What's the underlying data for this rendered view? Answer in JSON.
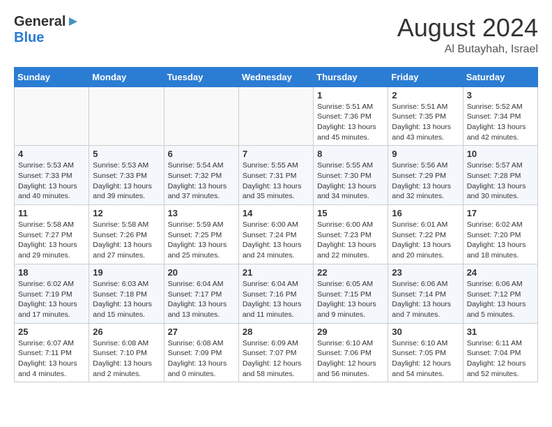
{
  "header": {
    "logo_general": "General",
    "logo_blue": "Blue",
    "month_year": "August 2024",
    "location": "Al Butayhah, Israel"
  },
  "weekdays": [
    "Sunday",
    "Monday",
    "Tuesday",
    "Wednesday",
    "Thursday",
    "Friday",
    "Saturday"
  ],
  "weeks": [
    [
      {
        "day": "",
        "info": ""
      },
      {
        "day": "",
        "info": ""
      },
      {
        "day": "",
        "info": ""
      },
      {
        "day": "",
        "info": ""
      },
      {
        "day": "1",
        "info": "Sunrise: 5:51 AM\nSunset: 7:36 PM\nDaylight: 13 hours\nand 45 minutes."
      },
      {
        "day": "2",
        "info": "Sunrise: 5:51 AM\nSunset: 7:35 PM\nDaylight: 13 hours\nand 43 minutes."
      },
      {
        "day": "3",
        "info": "Sunrise: 5:52 AM\nSunset: 7:34 PM\nDaylight: 13 hours\nand 42 minutes."
      }
    ],
    [
      {
        "day": "4",
        "info": "Sunrise: 5:53 AM\nSunset: 7:33 PM\nDaylight: 13 hours\nand 40 minutes."
      },
      {
        "day": "5",
        "info": "Sunrise: 5:53 AM\nSunset: 7:33 PM\nDaylight: 13 hours\nand 39 minutes."
      },
      {
        "day": "6",
        "info": "Sunrise: 5:54 AM\nSunset: 7:32 PM\nDaylight: 13 hours\nand 37 minutes."
      },
      {
        "day": "7",
        "info": "Sunrise: 5:55 AM\nSunset: 7:31 PM\nDaylight: 13 hours\nand 35 minutes."
      },
      {
        "day": "8",
        "info": "Sunrise: 5:55 AM\nSunset: 7:30 PM\nDaylight: 13 hours\nand 34 minutes."
      },
      {
        "day": "9",
        "info": "Sunrise: 5:56 AM\nSunset: 7:29 PM\nDaylight: 13 hours\nand 32 minutes."
      },
      {
        "day": "10",
        "info": "Sunrise: 5:57 AM\nSunset: 7:28 PM\nDaylight: 13 hours\nand 30 minutes."
      }
    ],
    [
      {
        "day": "11",
        "info": "Sunrise: 5:58 AM\nSunset: 7:27 PM\nDaylight: 13 hours\nand 29 minutes."
      },
      {
        "day": "12",
        "info": "Sunrise: 5:58 AM\nSunset: 7:26 PM\nDaylight: 13 hours\nand 27 minutes."
      },
      {
        "day": "13",
        "info": "Sunrise: 5:59 AM\nSunset: 7:25 PM\nDaylight: 13 hours\nand 25 minutes."
      },
      {
        "day": "14",
        "info": "Sunrise: 6:00 AM\nSunset: 7:24 PM\nDaylight: 13 hours\nand 24 minutes."
      },
      {
        "day": "15",
        "info": "Sunrise: 6:00 AM\nSunset: 7:23 PM\nDaylight: 13 hours\nand 22 minutes."
      },
      {
        "day": "16",
        "info": "Sunrise: 6:01 AM\nSunset: 7:22 PM\nDaylight: 13 hours\nand 20 minutes."
      },
      {
        "day": "17",
        "info": "Sunrise: 6:02 AM\nSunset: 7:20 PM\nDaylight: 13 hours\nand 18 minutes."
      }
    ],
    [
      {
        "day": "18",
        "info": "Sunrise: 6:02 AM\nSunset: 7:19 PM\nDaylight: 13 hours\nand 17 minutes."
      },
      {
        "day": "19",
        "info": "Sunrise: 6:03 AM\nSunset: 7:18 PM\nDaylight: 13 hours\nand 15 minutes."
      },
      {
        "day": "20",
        "info": "Sunrise: 6:04 AM\nSunset: 7:17 PM\nDaylight: 13 hours\nand 13 minutes."
      },
      {
        "day": "21",
        "info": "Sunrise: 6:04 AM\nSunset: 7:16 PM\nDaylight: 13 hours\nand 11 minutes."
      },
      {
        "day": "22",
        "info": "Sunrise: 6:05 AM\nSunset: 7:15 PM\nDaylight: 13 hours\nand 9 minutes."
      },
      {
        "day": "23",
        "info": "Sunrise: 6:06 AM\nSunset: 7:14 PM\nDaylight: 13 hours\nand 7 minutes."
      },
      {
        "day": "24",
        "info": "Sunrise: 6:06 AM\nSunset: 7:12 PM\nDaylight: 13 hours\nand 5 minutes."
      }
    ],
    [
      {
        "day": "25",
        "info": "Sunrise: 6:07 AM\nSunset: 7:11 PM\nDaylight: 13 hours\nand 4 minutes."
      },
      {
        "day": "26",
        "info": "Sunrise: 6:08 AM\nSunset: 7:10 PM\nDaylight: 13 hours\nand 2 minutes."
      },
      {
        "day": "27",
        "info": "Sunrise: 6:08 AM\nSunset: 7:09 PM\nDaylight: 13 hours\nand 0 minutes."
      },
      {
        "day": "28",
        "info": "Sunrise: 6:09 AM\nSunset: 7:07 PM\nDaylight: 12 hours\nand 58 minutes."
      },
      {
        "day": "29",
        "info": "Sunrise: 6:10 AM\nSunset: 7:06 PM\nDaylight: 12 hours\nand 56 minutes."
      },
      {
        "day": "30",
        "info": "Sunrise: 6:10 AM\nSunset: 7:05 PM\nDaylight: 12 hours\nand 54 minutes."
      },
      {
        "day": "31",
        "info": "Sunrise: 6:11 AM\nSunset: 7:04 PM\nDaylight: 12 hours\nand 52 minutes."
      }
    ]
  ]
}
